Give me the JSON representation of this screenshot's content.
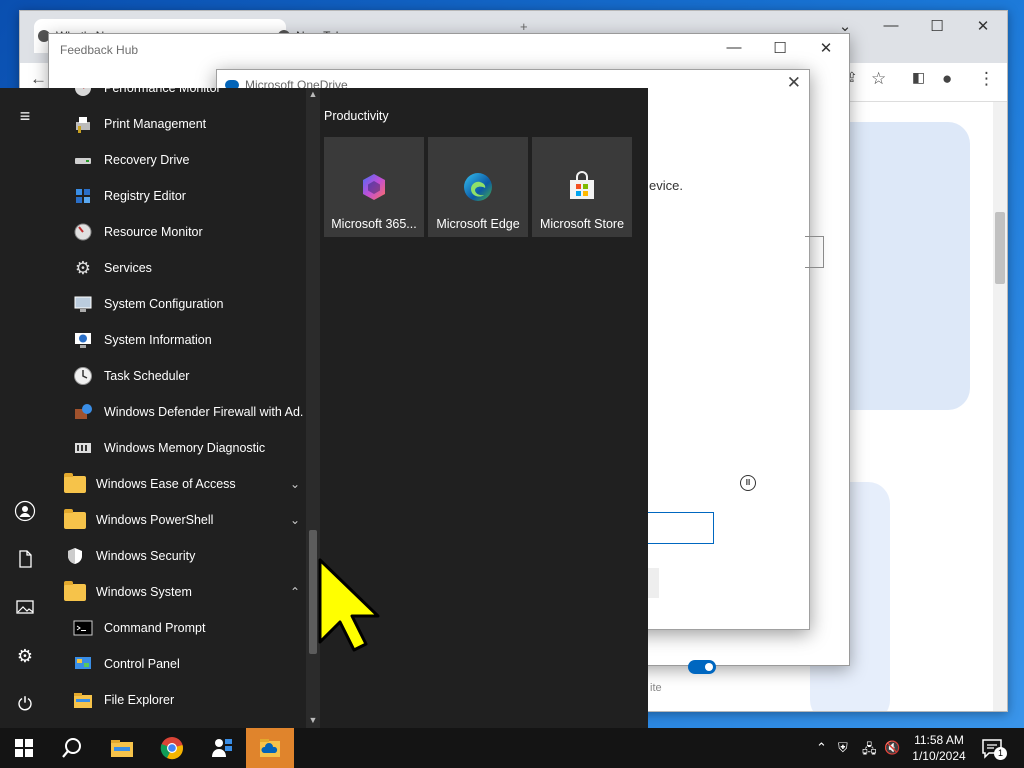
{
  "chrome": {
    "tabs": [
      {
        "label": "What's N"
      },
      {
        "label": "New Tab"
      }
    ]
  },
  "feedback_hub": {
    "title": "Feedback Hub"
  },
  "onedrive": {
    "title": "Microsoft OneDrive",
    "partial_text": "evice.",
    "partial_label": "ite"
  },
  "start_menu": {
    "apps": [
      {
        "label": "Performance Monitor",
        "icon": "performance-monitor-icon"
      },
      {
        "label": "Print Management",
        "icon": "print-management-icon"
      },
      {
        "label": "Recovery Drive",
        "icon": "recovery-drive-icon"
      },
      {
        "label": "Registry Editor",
        "icon": "registry-editor-icon"
      },
      {
        "label": "Resource Monitor",
        "icon": "resource-monitor-icon"
      },
      {
        "label": "Services",
        "icon": "services-icon"
      },
      {
        "label": "System Configuration",
        "icon": "system-configuration-icon"
      },
      {
        "label": "System Information",
        "icon": "system-information-icon"
      },
      {
        "label": "Task Scheduler",
        "icon": "task-scheduler-icon"
      },
      {
        "label": "Windows Defender Firewall with Ad...",
        "icon": "firewall-icon"
      },
      {
        "label": "Windows Memory Diagnostic",
        "icon": "memory-diagnostic-icon"
      },
      {
        "label": "Windows Ease of Access",
        "icon": "folder-icon",
        "folder": true,
        "expanded": false
      },
      {
        "label": "Windows PowerShell",
        "icon": "folder-icon",
        "folder": true,
        "expanded": false
      },
      {
        "label": "Windows Security",
        "icon": "shield-icon",
        "folder": true
      },
      {
        "label": "Windows System",
        "icon": "folder-icon",
        "folder": true,
        "expanded": true
      },
      {
        "label": "Command Prompt",
        "icon": "command-prompt-icon"
      },
      {
        "label": "Control Panel",
        "icon": "control-panel-icon"
      },
      {
        "label": "File Explorer",
        "icon": "file-explorer-icon"
      }
    ],
    "tiles_group": "Productivity",
    "tiles": [
      {
        "label": "Microsoft 365...",
        "icon": "microsoft-365-icon"
      },
      {
        "label": "Microsoft Edge",
        "icon": "edge-icon"
      },
      {
        "label": "Microsoft Store",
        "icon": "store-icon"
      }
    ],
    "nav_icons": [
      "hamburger-icon",
      "user-icon",
      "document-icon",
      "pictures-icon",
      "settings-icon",
      "power-icon"
    ]
  },
  "taskbar": {
    "items": [
      "start-icon",
      "search-icon",
      "file-explorer-icon",
      "chrome-icon",
      "people-icon",
      "onedrive-setup-icon"
    ],
    "time": "11:58 AM",
    "date": "1/10/2024",
    "notification_count": "1"
  },
  "colors": {
    "start_bg": "#202020",
    "tile_bg": "#3a3a3a",
    "taskbar_bg": "#141414",
    "active_task": "#e0842c",
    "cursor": "#ffff00",
    "accent": "#0067c0"
  }
}
